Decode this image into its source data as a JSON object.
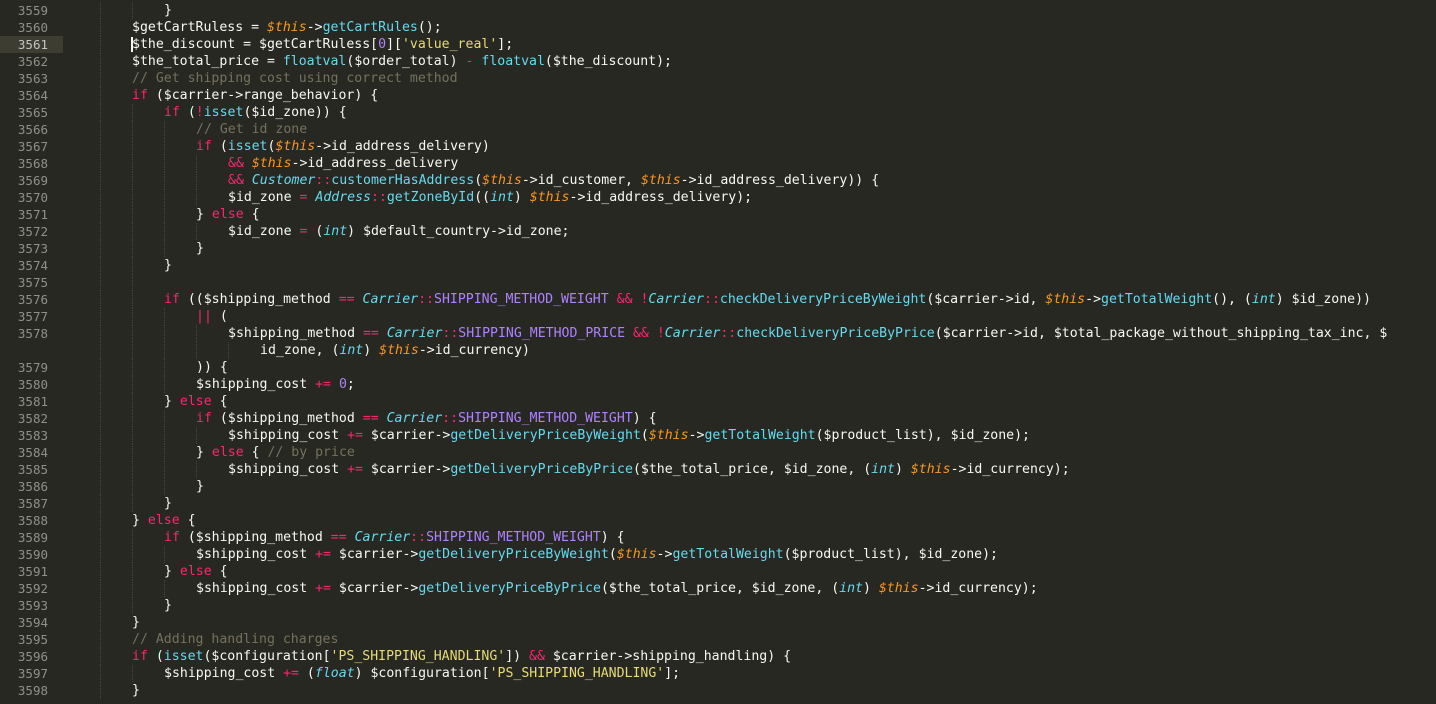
{
  "colors": {
    "background": "#272822",
    "line_number": "#8f908a",
    "text": "#f8f8f2",
    "keyword": "#f92672",
    "function": "#66d9ef",
    "this": "#fd971f",
    "string": "#e6db74",
    "number": "#ae81ff",
    "comment": "#75715e"
  },
  "editor": {
    "active_line": "3561",
    "lines": [
      {
        "num": "3559",
        "indent": 2,
        "tokens": [
          [
            "txt",
            "}"
          ]
        ]
      },
      {
        "num": "3560",
        "indent": 1,
        "tokens": [
          [
            "txt",
            "$getCartRuless = "
          ],
          [
            "this",
            "$this"
          ],
          [
            "txt",
            "->"
          ],
          [
            "fn",
            "getCartRules"
          ],
          [
            "txt",
            "();"
          ]
        ]
      },
      {
        "num": "3561",
        "indent": 1,
        "tokens": [
          [
            "txt",
            "$the_discount = $getCartRuless["
          ],
          [
            "num",
            "0"
          ],
          [
            "txt",
            "]["
          ],
          [
            "str",
            "'value_real'"
          ],
          [
            "txt",
            "];"
          ]
        ]
      },
      {
        "num": "3562",
        "indent": 1,
        "tokens": [
          [
            "txt",
            "$the_total_price = "
          ],
          [
            "fn",
            "floatval"
          ],
          [
            "txt",
            "($order_total) "
          ],
          [
            "op",
            "-"
          ],
          [
            "txt",
            " "
          ],
          [
            "fn",
            "floatval"
          ],
          [
            "txt",
            "($the_discount);"
          ]
        ]
      },
      {
        "num": "3563",
        "indent": 1,
        "tokens": [
          [
            "com",
            "// Get shipping cost using correct method"
          ]
        ]
      },
      {
        "num": "3564",
        "indent": 1,
        "tokens": [
          [
            "kw",
            "if"
          ],
          [
            "txt",
            " ($carrier->range_behavior) {"
          ]
        ]
      },
      {
        "num": "3565",
        "indent": 2,
        "tokens": [
          [
            "kw",
            "if"
          ],
          [
            "txt",
            " ("
          ],
          [
            "op",
            "!"
          ],
          [
            "fn",
            "isset"
          ],
          [
            "txt",
            "($id_zone)) {"
          ]
        ]
      },
      {
        "num": "3566",
        "indent": 3,
        "tokens": [
          [
            "com",
            "// Get id zone"
          ]
        ]
      },
      {
        "num": "3567",
        "indent": 3,
        "tokens": [
          [
            "kw",
            "if"
          ],
          [
            "txt",
            " ("
          ],
          [
            "fn",
            "isset"
          ],
          [
            "txt",
            "("
          ],
          [
            "this",
            "$this"
          ],
          [
            "txt",
            "->id_address_delivery)"
          ]
        ]
      },
      {
        "num": "3568",
        "indent": 4,
        "tokens": [
          [
            "op",
            "&&"
          ],
          [
            "txt",
            " "
          ],
          [
            "this",
            "$this"
          ],
          [
            "txt",
            "->id_address_delivery"
          ]
        ]
      },
      {
        "num": "3569",
        "indent": 4,
        "tokens": [
          [
            "op",
            "&&"
          ],
          [
            "txt",
            " "
          ],
          [
            "cls",
            "Customer"
          ],
          [
            "op",
            "::"
          ],
          [
            "fn",
            "customerHasAddress"
          ],
          [
            "txt",
            "("
          ],
          [
            "this",
            "$this"
          ],
          [
            "txt",
            "->id_customer, "
          ],
          [
            "this",
            "$this"
          ],
          [
            "txt",
            "->id_address_delivery)) {"
          ]
        ]
      },
      {
        "num": "3570",
        "indent": 4,
        "tokens": [
          [
            "txt",
            "$id_zone "
          ],
          [
            "op",
            "="
          ],
          [
            "txt",
            " "
          ],
          [
            "cls",
            "Address"
          ],
          [
            "op",
            "::"
          ],
          [
            "fn",
            "getZoneById"
          ],
          [
            "txt",
            "(("
          ],
          [
            "type",
            "int"
          ],
          [
            "txt",
            ") "
          ],
          [
            "this",
            "$this"
          ],
          [
            "txt",
            "->id_address_delivery);"
          ]
        ]
      },
      {
        "num": "3571",
        "indent": 3,
        "tokens": [
          [
            "txt",
            "} "
          ],
          [
            "kw",
            "else"
          ],
          [
            "txt",
            " {"
          ]
        ]
      },
      {
        "num": "3572",
        "indent": 4,
        "tokens": [
          [
            "txt",
            "$id_zone "
          ],
          [
            "op",
            "="
          ],
          [
            "txt",
            " ("
          ],
          [
            "type",
            "int"
          ],
          [
            "txt",
            ") $default_country->id_zone;"
          ]
        ]
      },
      {
        "num": "3573",
        "indent": 3,
        "tokens": [
          [
            "txt",
            "}"
          ]
        ]
      },
      {
        "num": "3574",
        "indent": 2,
        "tokens": [
          [
            "txt",
            "}"
          ]
        ]
      },
      {
        "num": "3575",
        "indent": 2,
        "tokens": []
      },
      {
        "num": "3576",
        "indent": 2,
        "tokens": [
          [
            "kw",
            "if"
          ],
          [
            "txt",
            " (($shipping_method "
          ],
          [
            "op",
            "=="
          ],
          [
            "txt",
            " "
          ],
          [
            "cls",
            "Carrier"
          ],
          [
            "op",
            "::"
          ],
          [
            "const",
            "SHIPPING_METHOD_WEIGHT"
          ],
          [
            "txt",
            " "
          ],
          [
            "op",
            "&&"
          ],
          [
            "txt",
            " "
          ],
          [
            "op",
            "!"
          ],
          [
            "cls",
            "Carrier"
          ],
          [
            "op",
            "::"
          ],
          [
            "fn",
            "checkDeliveryPriceByWeight"
          ],
          [
            "txt",
            "($carrier->id, "
          ],
          [
            "this",
            "$this"
          ],
          [
            "txt",
            "->"
          ],
          [
            "fn",
            "getTotalWeight"
          ],
          [
            "txt",
            "(), ("
          ],
          [
            "type",
            "int"
          ],
          [
            "txt",
            ") $id_zone))"
          ]
        ]
      },
      {
        "num": "3577",
        "indent": 3,
        "tokens": [
          [
            "op",
            "||"
          ],
          [
            "txt",
            " ("
          ]
        ]
      },
      {
        "num": "3578",
        "indent": 4,
        "tokens": [
          [
            "txt",
            "$shipping_method "
          ],
          [
            "op",
            "=="
          ],
          [
            "txt",
            " "
          ],
          [
            "cls",
            "Carrier"
          ],
          [
            "op",
            "::"
          ],
          [
            "const",
            "SHIPPING_METHOD_PRICE"
          ],
          [
            "txt",
            " "
          ],
          [
            "op",
            "&&"
          ],
          [
            "txt",
            " "
          ],
          [
            "op",
            "!"
          ],
          [
            "cls",
            "Carrier"
          ],
          [
            "op",
            "::"
          ],
          [
            "fn",
            "checkDeliveryPriceByPrice"
          ],
          [
            "txt",
            "($carrier->id, $total_package_without_shipping_tax_inc, $"
          ]
        ]
      },
      {
        "num": "",
        "indent": 5,
        "tokens": [
          [
            "txt",
            "id_zone, ("
          ],
          [
            "type",
            "int"
          ],
          [
            "txt",
            ") "
          ],
          [
            "this",
            "$this"
          ],
          [
            "txt",
            "->id_currency)"
          ]
        ]
      },
      {
        "num": "3579",
        "indent": 3,
        "tokens": [
          [
            "txt",
            ")) {"
          ]
        ]
      },
      {
        "num": "3580",
        "indent": 3,
        "tokens": [
          [
            "txt",
            "$shipping_cost "
          ],
          [
            "op",
            "+="
          ],
          [
            "txt",
            " "
          ],
          [
            "num",
            "0"
          ],
          [
            "txt",
            ";"
          ]
        ]
      },
      {
        "num": "3581",
        "indent": 2,
        "tokens": [
          [
            "txt",
            "} "
          ],
          [
            "kw",
            "else"
          ],
          [
            "txt",
            " {"
          ]
        ]
      },
      {
        "num": "3582",
        "indent": 3,
        "tokens": [
          [
            "kw",
            "if"
          ],
          [
            "txt",
            " ($shipping_method "
          ],
          [
            "op",
            "=="
          ],
          [
            "txt",
            " "
          ],
          [
            "cls",
            "Carrier"
          ],
          [
            "op",
            "::"
          ],
          [
            "const",
            "SHIPPING_METHOD_WEIGHT"
          ],
          [
            "txt",
            ") {"
          ]
        ]
      },
      {
        "num": "3583",
        "indent": 4,
        "tokens": [
          [
            "txt",
            "$shipping_cost "
          ],
          [
            "op",
            "+="
          ],
          [
            "txt",
            " $carrier->"
          ],
          [
            "fn",
            "getDeliveryPriceByWeight"
          ],
          [
            "txt",
            "("
          ],
          [
            "this",
            "$this"
          ],
          [
            "txt",
            "->"
          ],
          [
            "fn",
            "getTotalWeight"
          ],
          [
            "txt",
            "($product_list), $id_zone);"
          ]
        ]
      },
      {
        "num": "3584",
        "indent": 3,
        "tokens": [
          [
            "txt",
            "} "
          ],
          [
            "kw",
            "else"
          ],
          [
            "txt",
            " { "
          ],
          [
            "com",
            "// by price"
          ]
        ]
      },
      {
        "num": "3585",
        "indent": 4,
        "tokens": [
          [
            "txt",
            "$shipping_cost "
          ],
          [
            "op",
            "+="
          ],
          [
            "txt",
            " $carrier->"
          ],
          [
            "fn",
            "getDeliveryPriceByPrice"
          ],
          [
            "txt",
            "($the_total_price, $id_zone, ("
          ],
          [
            "type",
            "int"
          ],
          [
            "txt",
            ") "
          ],
          [
            "this",
            "$this"
          ],
          [
            "txt",
            "->id_currency);"
          ]
        ]
      },
      {
        "num": "3586",
        "indent": 3,
        "tokens": [
          [
            "txt",
            "}"
          ]
        ]
      },
      {
        "num": "3587",
        "indent": 2,
        "tokens": [
          [
            "txt",
            "}"
          ]
        ]
      },
      {
        "num": "3588",
        "indent": 1,
        "tokens": [
          [
            "txt",
            "} "
          ],
          [
            "kw",
            "else"
          ],
          [
            "txt",
            " {"
          ]
        ]
      },
      {
        "num": "3589",
        "indent": 2,
        "tokens": [
          [
            "kw",
            "if"
          ],
          [
            "txt",
            " ($shipping_method "
          ],
          [
            "op",
            "=="
          ],
          [
            "txt",
            " "
          ],
          [
            "cls",
            "Carrier"
          ],
          [
            "op",
            "::"
          ],
          [
            "const",
            "SHIPPING_METHOD_WEIGHT"
          ],
          [
            "txt",
            ") {"
          ]
        ]
      },
      {
        "num": "3590",
        "indent": 3,
        "tokens": [
          [
            "txt",
            "$shipping_cost "
          ],
          [
            "op",
            "+="
          ],
          [
            "txt",
            " $carrier->"
          ],
          [
            "fn",
            "getDeliveryPriceByWeight"
          ],
          [
            "txt",
            "("
          ],
          [
            "this",
            "$this"
          ],
          [
            "txt",
            "->"
          ],
          [
            "fn",
            "getTotalWeight"
          ],
          [
            "txt",
            "($product_list), $id_zone);"
          ]
        ]
      },
      {
        "num": "3591",
        "indent": 2,
        "tokens": [
          [
            "txt",
            "} "
          ],
          [
            "kw",
            "else"
          ],
          [
            "txt",
            " {"
          ]
        ]
      },
      {
        "num": "3592",
        "indent": 3,
        "tokens": [
          [
            "txt",
            "$shipping_cost "
          ],
          [
            "op",
            "+="
          ],
          [
            "txt",
            " $carrier->"
          ],
          [
            "fn",
            "getDeliveryPriceByPrice"
          ],
          [
            "txt",
            "($the_total_price, $id_zone, ("
          ],
          [
            "type",
            "int"
          ],
          [
            "txt",
            ") "
          ],
          [
            "this",
            "$this"
          ],
          [
            "txt",
            "->id_currency);"
          ]
        ]
      },
      {
        "num": "3593",
        "indent": 2,
        "tokens": [
          [
            "txt",
            "}"
          ]
        ]
      },
      {
        "num": "3594",
        "indent": 1,
        "tokens": [
          [
            "txt",
            "}"
          ]
        ]
      },
      {
        "num": "3595",
        "indent": 1,
        "tokens": [
          [
            "com",
            "// Adding handling charges"
          ]
        ]
      },
      {
        "num": "3596",
        "indent": 1,
        "tokens": [
          [
            "kw",
            "if"
          ],
          [
            "txt",
            " ("
          ],
          [
            "fn",
            "isset"
          ],
          [
            "txt",
            "($configuration["
          ],
          [
            "str",
            "'PS_SHIPPING_HANDLING'"
          ],
          [
            "txt",
            "]) "
          ],
          [
            "op",
            "&&"
          ],
          [
            "txt",
            " $carrier->shipping_handling) {"
          ]
        ]
      },
      {
        "num": "3597",
        "indent": 2,
        "tokens": [
          [
            "txt",
            "$shipping_cost "
          ],
          [
            "op",
            "+="
          ],
          [
            "txt",
            " ("
          ],
          [
            "type",
            "float"
          ],
          [
            "txt",
            ") $configuration["
          ],
          [
            "str",
            "'PS_SHIPPING_HANDLING'"
          ],
          [
            "txt",
            "];"
          ]
        ]
      },
      {
        "num": "3598",
        "indent": 1,
        "tokens": [
          [
            "txt",
            "}"
          ]
        ]
      }
    ]
  }
}
